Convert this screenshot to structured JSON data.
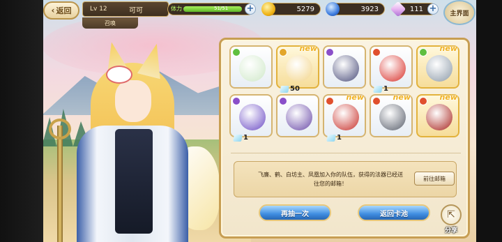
{
  "topbar": {
    "back_label": "返回",
    "level": "Lv 12",
    "player_name": "可可",
    "subtitle": "召唤",
    "stamina_label": "体力",
    "stamina_value": "51/51",
    "stamina_fraction": 1.0,
    "gold": "5279",
    "gems": "3923",
    "crystals": "111",
    "home_label": "主界面"
  },
  "results": {
    "cards": [
      {
        "element": "wind",
        "element_color": "#5fbf3f",
        "is_new": false,
        "new_label": "",
        "qty": "",
        "rarity": "normal",
        "art": "white-bag-green-spirit-icon",
        "art_color": "#cfe8c8"
      },
      {
        "element": "earth",
        "element_color": "#e3a62a",
        "is_new": true,
        "new_label": "new",
        "qty": "50",
        "rarity": "gold",
        "art": "golden-ring-icon",
        "art_color": "#f3d488"
      },
      {
        "element": "dark",
        "element_color": "#8a4fc9",
        "is_new": false,
        "new_label": "",
        "qty": "",
        "rarity": "normal",
        "art": "dark-creature-icon",
        "art_color": "#4a4d7a"
      },
      {
        "element": "fire",
        "element_color": "#e0502e",
        "is_new": false,
        "new_label": "",
        "qty": "1",
        "rarity": "normal",
        "art": "red-orb-icon",
        "art_color": "#d8302a"
      },
      {
        "element": "wind",
        "element_color": "#5fbf3f",
        "is_new": true,
        "new_label": "new",
        "qty": "",
        "rarity": "gold",
        "art": "white-bird-icon",
        "art_color": "#8c9aa8"
      },
      {
        "element": "dark",
        "element_color": "#8a4fc9",
        "is_new": false,
        "new_label": "",
        "qty": "1",
        "rarity": "normal",
        "art": "purple-stars-icon",
        "art_color": "#6b4bc4"
      },
      {
        "element": "dark",
        "element_color": "#8a4fc9",
        "is_new": false,
        "new_label": "",
        "qty": "",
        "rarity": "normal",
        "art": "crossbow-icon",
        "art_color": "#6a4aa8"
      },
      {
        "element": "fire",
        "element_color": "#e0502e",
        "is_new": true,
        "new_label": "new",
        "qty": "1",
        "rarity": "normal",
        "art": "red-bomb-icon",
        "art_color": "#c8302a"
      },
      {
        "element": "fire",
        "element_color": "#e0502e",
        "is_new": true,
        "new_label": "new",
        "qty": "",
        "rarity": "normal",
        "art": "white-crane-icon",
        "art_color": "#575d6a"
      },
      {
        "element": "fire",
        "element_color": "#e0502e",
        "is_new": true,
        "new_label": "new",
        "qty": "",
        "rarity": "gold",
        "art": "phoenix-fan-icon",
        "art_color": "#a8241e"
      }
    ],
    "message_line1": "飞廉、鹤、白坊主、凤凰加入你的队伍，获得的法器已经送",
    "message_line2": "往您的邮箱！",
    "mail_button": "前往邮箱",
    "draw_again": "再抽一次",
    "return_pool": "返回卡池",
    "share_label": "分享"
  }
}
